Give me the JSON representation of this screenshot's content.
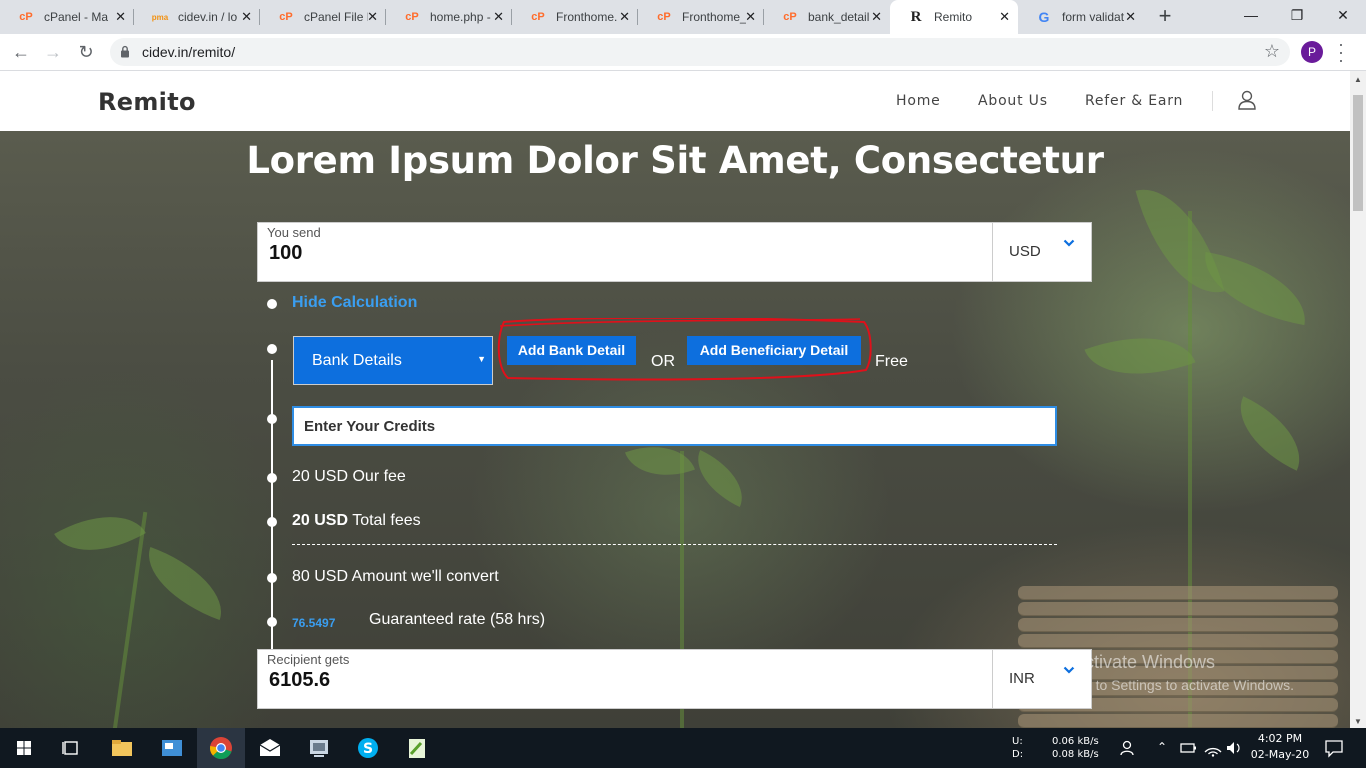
{
  "browser": {
    "tabs": [
      {
        "title": "cPanel - Ma",
        "favicon": "cpanel-icon"
      },
      {
        "title": "cidev.in / lo",
        "favicon": "phpmyadmin-icon"
      },
      {
        "title": "cPanel File M",
        "favicon": "cpanel-icon"
      },
      {
        "title": "home.php - ",
        "favicon": "cpanel-icon"
      },
      {
        "title": "Fronthome.",
        "favicon": "cpanel-icon"
      },
      {
        "title": "Fronthome_",
        "favicon": "cpanel-icon"
      },
      {
        "title": "bank_detail",
        "favicon": "cpanel-icon"
      },
      {
        "title": "Remito",
        "favicon": "remito-icon"
      },
      {
        "title": "form validat",
        "favicon": "google-icon"
      }
    ],
    "active_tab_index": 7,
    "url": "cidev.in/remito/",
    "profile_initial": "P"
  },
  "site": {
    "logo": "Remito",
    "nav": [
      "Home",
      "About Us",
      "Refer & Earn"
    ]
  },
  "hero": {
    "title": "Lorem Ipsum Dolor Sit Amet, Consectetur"
  },
  "send": {
    "label": "You send",
    "value": "100",
    "currency": "USD"
  },
  "calc": {
    "toggle_label": "Hide Calculation",
    "bank_select_value": "Bank Details",
    "add_bank_label": "Add Bank Detail",
    "or_label": "OR",
    "add_beneficiary_label": "Add Beneficiary Detail",
    "free_label": "Free",
    "credits_placeholder": "Enter Your Credits",
    "our_fee_text": "20 USD Our fee",
    "total_fee_amount": "20 USD",
    "total_fee_label": " Total fees",
    "convert_text": "80 USD Amount we'll convert",
    "rate_value": "76.5497",
    "rate_label": "Guaranteed rate (58 hrs)"
  },
  "receive": {
    "label": "Recipient gets",
    "value": "6105.6",
    "currency": "INR"
  },
  "watermark": {
    "title": "Activate Windows",
    "subtitle": "Go to Settings to activate Windows."
  },
  "taskbar": {
    "net_up_label": "U:",
    "net_down_label": "D:",
    "net_up": "0.06 kB/s",
    "net_down": "0.08 kB/s",
    "time": "4:02 PM",
    "date": "02-May-20"
  }
}
